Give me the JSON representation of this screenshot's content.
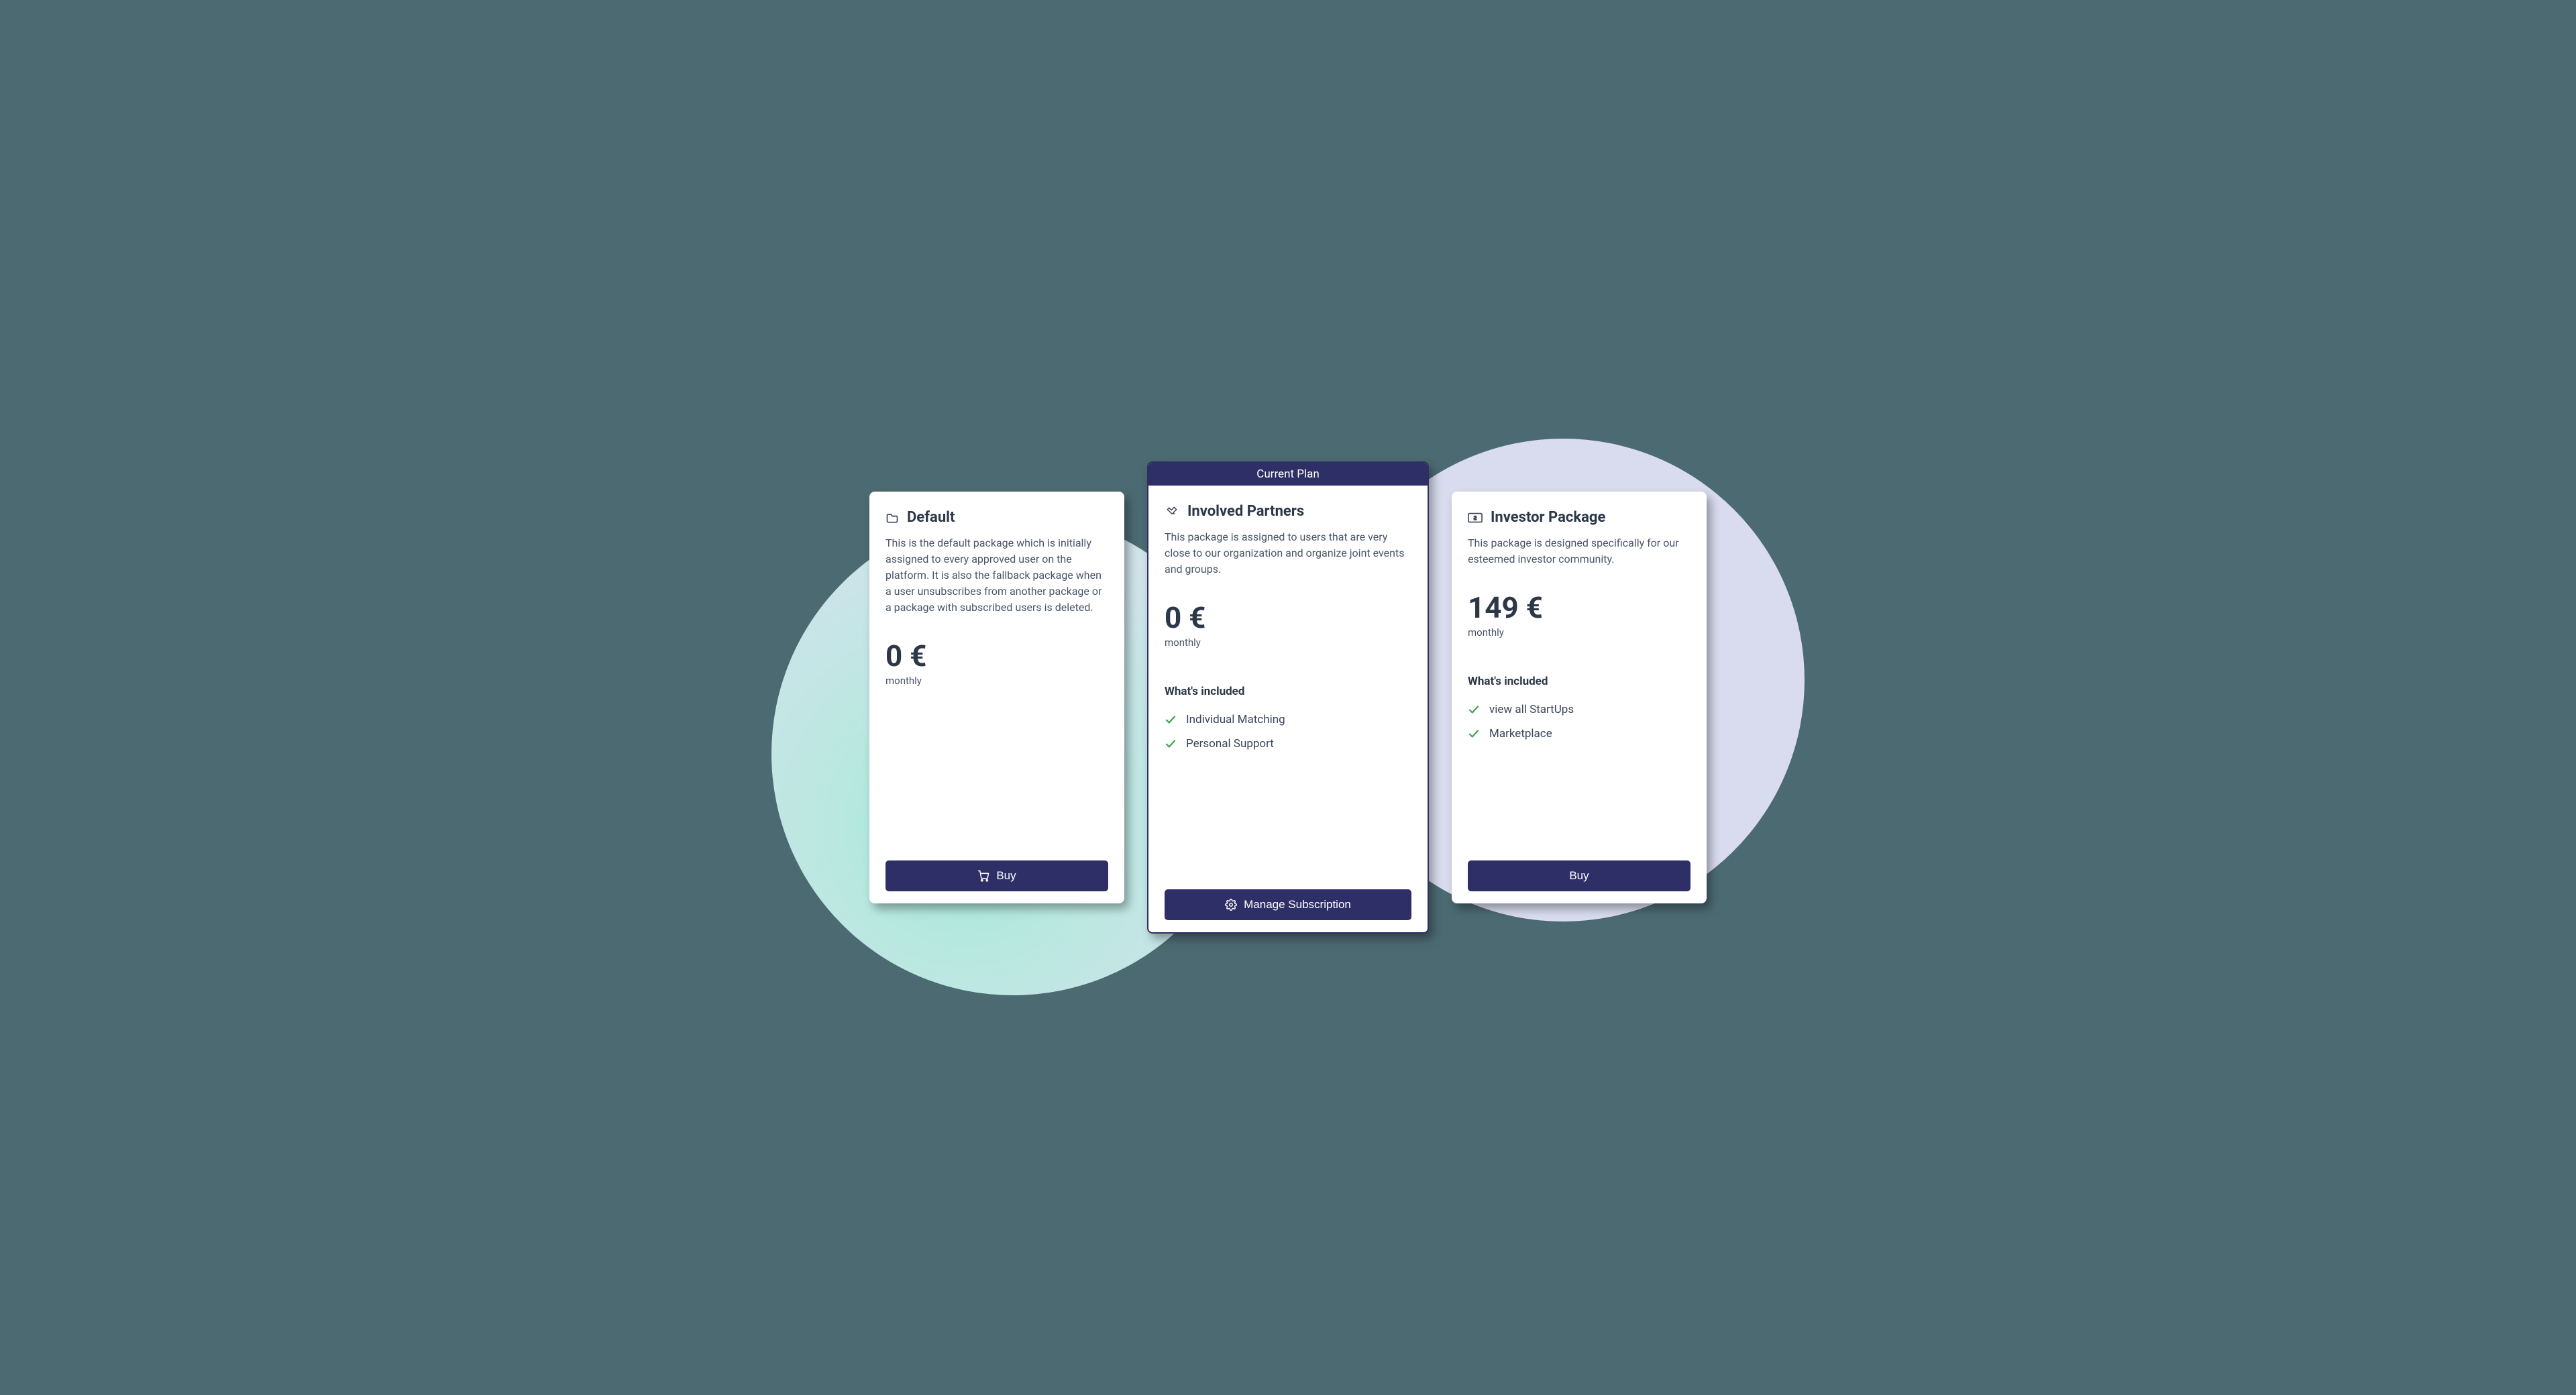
{
  "common": {
    "included_heading": "What's included"
  },
  "plans": [
    {
      "id": "default",
      "title": "Default",
      "description": "This is the default package which is initially assigned to every approved user on the platform. It is also the fallback package when a user unsubscribes from another package or a package with subscribed users is deleted.",
      "price": "0 €",
      "period": "monthly",
      "features": [],
      "cta_label": "Buy",
      "cta_icon": "cart-icon",
      "title_icon": "folder-icon",
      "current": false
    },
    {
      "id": "involved-partners",
      "title": "Involved Partners",
      "description": "This package is assigned to users that are very close to our organization and organize joint events and groups.",
      "price": "0 €",
      "period": "monthly",
      "features": [
        "Individual Matching",
        "Personal Support"
      ],
      "cta_label": "Manage Subscription",
      "cta_icon": "gear-icon",
      "title_icon": "handshake-icon",
      "current": true,
      "banner": "Current Plan"
    },
    {
      "id": "investor",
      "title": "Investor Package",
      "description": "This package is designed specifically for our esteemed investor community.",
      "price": "149 €",
      "period": "monthly",
      "features": [
        "view all StartUps",
        "Marketplace"
      ],
      "cta_label": "Buy",
      "cta_icon": null,
      "title_icon": "money-icon",
      "current": false
    }
  ]
}
